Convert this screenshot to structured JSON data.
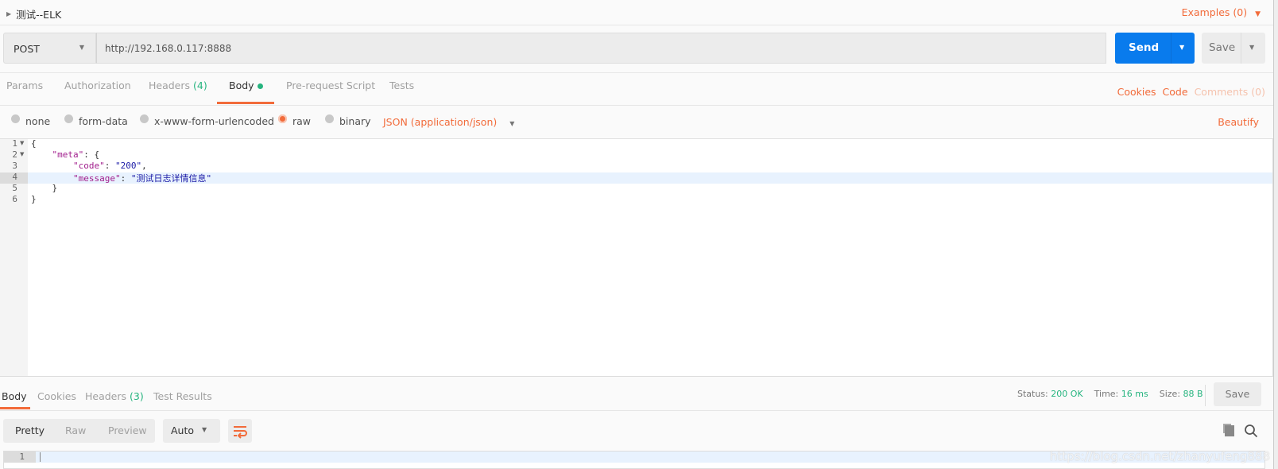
{
  "request": {
    "title": "测试--ELK",
    "examples": "Examples (0)",
    "method": "POST",
    "url": "http://192.168.0.117:8888",
    "send": "Send",
    "save": "Save",
    "tabs": [
      {
        "label": "Params"
      },
      {
        "label": "Authorization"
      },
      {
        "label": "Headers",
        "count": "(4)"
      },
      {
        "label": "Body",
        "active": true
      },
      {
        "label": "Pre-request Script"
      },
      {
        "label": "Tests"
      }
    ],
    "links": {
      "cookies": "Cookies",
      "code": "Code",
      "comments": "Comments (0)"
    },
    "body_types": [
      "none",
      "form-data",
      "x-www-form-urlencoded",
      "raw",
      "binary"
    ],
    "selected_body_type": "raw",
    "content_type": "JSON (application/json)",
    "beautify": "Beautify",
    "editor": {
      "line_numbers": [
        "1",
        "2",
        "3",
        "4",
        "5",
        "6"
      ],
      "active_line": 4,
      "lines": [
        "{",
        "    \"meta\": {",
        "        \"code\": \"200\",",
        "        \"message\": \"测试日志详情信息\"",
        "    }",
        "}"
      ],
      "meta_key": "\"meta\"",
      "code_key": "\"code\"",
      "code_value": "\"200\"",
      "message_key": "\"message\"",
      "message_value": "\"测试日志详情信息\""
    }
  },
  "response": {
    "tabs": [
      {
        "label": "Body",
        "active": true
      },
      {
        "label": "Cookies"
      },
      {
        "label": "Headers",
        "count": "(3)"
      },
      {
        "label": "Test Results"
      }
    ],
    "status_label": "Status:",
    "status": "200 OK",
    "time_label": "Time:",
    "time": "16 ms",
    "size_label": "Size:",
    "size": "88 B",
    "save": "Save",
    "views": [
      "Pretty",
      "Raw",
      "Preview"
    ],
    "format": "Auto",
    "line_numbers": [
      "1"
    ],
    "watermark": "https://blog.csdn.net/zhanyufeng888"
  },
  "colors": {
    "accent": "#f26b3a",
    "send": "#097bed",
    "success": "#26b47f"
  }
}
